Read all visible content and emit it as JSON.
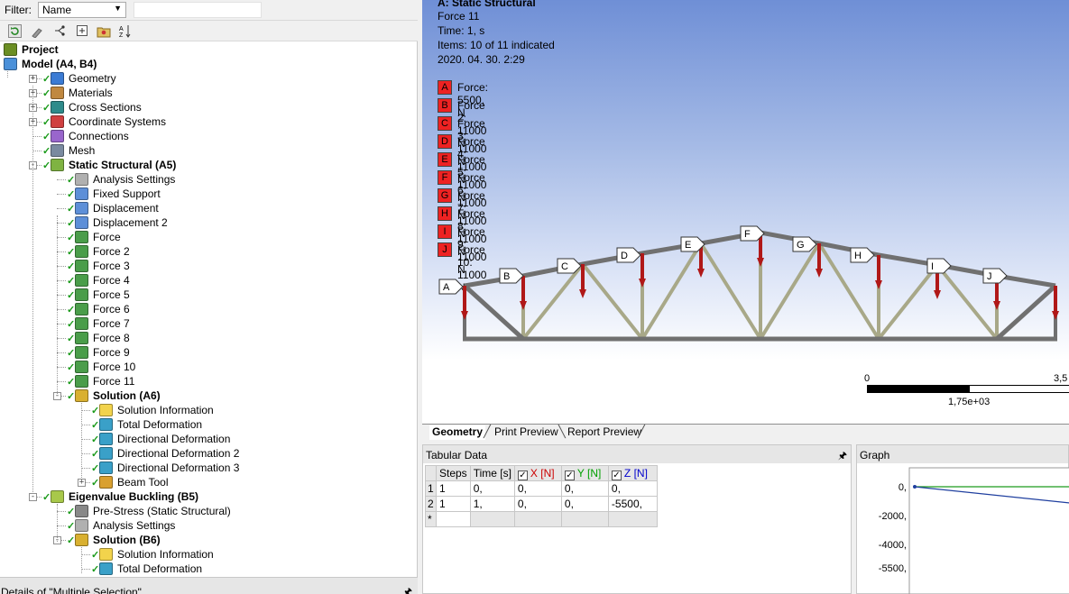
{
  "filter": {
    "label": "Filter:",
    "selected": "Name",
    "query": ""
  },
  "toolbar": {
    "icons": [
      "refresh-icon",
      "brush-icon",
      "tree-icon",
      "expand-icon",
      "folder-icon",
      "sort-az-icon"
    ]
  },
  "tree": [
    {
      "id": "project",
      "label": "Project",
      "bold": true,
      "level": 0,
      "icon": "project-icon",
      "color": "#6b8e23"
    },
    {
      "id": "model",
      "label": "Model (A4, B4)",
      "bold": true,
      "level": 0,
      "expander": "-",
      "icon": "model-icon",
      "color": "#4a90d9"
    },
    {
      "id": "geometry",
      "label": "Geometry",
      "level": 1,
      "expander": "+",
      "check": true,
      "icon": "geometry-icon",
      "color": "#3b7bd4"
    },
    {
      "id": "materials",
      "label": "Materials",
      "level": 1,
      "expander": "+",
      "check": true,
      "icon": "materials-icon",
      "color": "#c08840"
    },
    {
      "id": "cross-sections",
      "label": "Cross Sections",
      "level": 1,
      "expander": "+",
      "check": true,
      "icon": "cross-section-icon",
      "color": "#2e8b8b"
    },
    {
      "id": "coordinate-systems",
      "label": "Coordinate Systems",
      "level": 1,
      "expander": "+",
      "check": true,
      "icon": "coordinate-icon",
      "color": "#d04040"
    },
    {
      "id": "connections",
      "label": "Connections",
      "level": 1,
      "check": true,
      "icon": "connections-icon",
      "color": "#9966cc"
    },
    {
      "id": "mesh",
      "label": "Mesh",
      "level": 1,
      "check": true,
      "icon": "mesh-icon",
      "color": "#7a8aa0"
    },
    {
      "id": "static-structural",
      "label": "Static Structural (A5)",
      "bold": true,
      "level": 1,
      "expander": "-",
      "check": true,
      "icon": "static-structural-icon",
      "color": "#7fb342"
    },
    {
      "id": "analysis-settings",
      "label": "Analysis Settings",
      "level": 2,
      "check": true,
      "icon": "analysis-settings-icon",
      "color": "#b0b0b0"
    },
    {
      "id": "fixed-support",
      "label": "Fixed Support",
      "level": 2,
      "check": true,
      "icon": "fixed-support-icon",
      "color": "#5d8fd8"
    },
    {
      "id": "displacement",
      "label": "Displacement",
      "level": 2,
      "check": true,
      "icon": "displacement-icon",
      "color": "#5d8fd8"
    },
    {
      "id": "displacement-2",
      "label": "Displacement 2",
      "level": 2,
      "check": true,
      "icon": "displacement-icon",
      "color": "#5d8fd8"
    },
    {
      "id": "force",
      "label": "Force",
      "level": 2,
      "check": true,
      "icon": "force-icon",
      "color": "#4a9d4a"
    },
    {
      "id": "force-2",
      "label": "Force 2",
      "level": 2,
      "check": true,
      "icon": "force-icon",
      "color": "#4a9d4a"
    },
    {
      "id": "force-3",
      "label": "Force 3",
      "level": 2,
      "check": true,
      "icon": "force-icon",
      "color": "#4a9d4a"
    },
    {
      "id": "force-4",
      "label": "Force 4",
      "level": 2,
      "check": true,
      "icon": "force-icon",
      "color": "#4a9d4a"
    },
    {
      "id": "force-5",
      "label": "Force 5",
      "level": 2,
      "check": true,
      "icon": "force-icon",
      "color": "#4a9d4a"
    },
    {
      "id": "force-6",
      "label": "Force 6",
      "level": 2,
      "check": true,
      "icon": "force-icon",
      "color": "#4a9d4a"
    },
    {
      "id": "force-7",
      "label": "Force 7",
      "level": 2,
      "check": true,
      "icon": "force-icon",
      "color": "#4a9d4a"
    },
    {
      "id": "force-8",
      "label": "Force 8",
      "level": 2,
      "check": true,
      "icon": "force-icon",
      "color": "#4a9d4a"
    },
    {
      "id": "force-9",
      "label": "Force 9",
      "level": 2,
      "check": true,
      "icon": "force-icon",
      "color": "#4a9d4a"
    },
    {
      "id": "force-10",
      "label": "Force 10",
      "level": 2,
      "check": true,
      "icon": "force-icon",
      "color": "#4a9d4a"
    },
    {
      "id": "force-11",
      "label": "Force 11",
      "level": 2,
      "check": true,
      "icon": "force-icon",
      "color": "#4a9d4a"
    },
    {
      "id": "solution-a6",
      "label": "Solution (A6)",
      "bold": true,
      "level": 2,
      "expander": "-",
      "check": true,
      "icon": "solution-icon",
      "color": "#d9b030"
    },
    {
      "id": "solution-information",
      "label": "Solution Information",
      "level": 3,
      "check": true,
      "icon": "solution-info-icon",
      "color": "#f2d34c"
    },
    {
      "id": "total-deformation",
      "label": "Total Deformation",
      "level": 3,
      "check": true,
      "icon": "result-icon",
      "color": "#3aa0c8"
    },
    {
      "id": "directional-deformation",
      "label": "Directional Deformation",
      "level": 3,
      "check": true,
      "icon": "result-icon",
      "color": "#3aa0c8"
    },
    {
      "id": "directional-deformation-2",
      "label": "Directional Deformation 2",
      "level": 3,
      "check": true,
      "icon": "result-icon",
      "color": "#3aa0c8"
    },
    {
      "id": "directional-deformation-3",
      "label": "Directional Deformation 3",
      "level": 3,
      "check": true,
      "icon": "result-icon",
      "color": "#3aa0c8"
    },
    {
      "id": "beam-tool",
      "label": "Beam Tool",
      "level": 3,
      "expander": "+",
      "check": true,
      "icon": "beam-tool-icon",
      "color": "#d9a030"
    },
    {
      "id": "eigenvalue-buckling",
      "label": "Eigenvalue Buckling (B5)",
      "bold": true,
      "level": 1,
      "expander": "-",
      "check": true,
      "icon": "eigenvalue-icon",
      "color": "#a8c84a"
    },
    {
      "id": "pre-stress",
      "label": "Pre-Stress (Static Structural)",
      "level": 2,
      "check": true,
      "icon": "pre-stress-icon",
      "color": "#888888"
    },
    {
      "id": "analysis-settings-b",
      "label": "Analysis Settings",
      "level": 2,
      "check": true,
      "icon": "analysis-settings-icon",
      "color": "#b0b0b0"
    },
    {
      "id": "solution-b6",
      "label": "Solution (B6)",
      "bold": true,
      "level": 2,
      "expander": "-",
      "check": true,
      "icon": "solution-icon",
      "color": "#d9b030"
    },
    {
      "id": "solution-information-b",
      "label": "Solution Information",
      "level": 3,
      "check": true,
      "icon": "solution-info-icon",
      "color": "#f2d34c"
    },
    {
      "id": "total-deformation-b",
      "label": "Total Deformation",
      "level": 3,
      "check": true,
      "icon": "result-icon",
      "color": "#3aa0c8"
    }
  ],
  "details": {
    "title": "Details of \"Multiple Selection\"",
    "pin_icon": "pin-icon"
  },
  "viewport": {
    "title": "A: Static Structural",
    "object": "Force 11",
    "time": "Time: 1, s",
    "items": "Items: 10 of 11 indicated",
    "date": "2020. 04. 30. 2:29",
    "legend": [
      {
        "key": "A",
        "text": "Force: 5500, N"
      },
      {
        "key": "B",
        "text": "Force 2: 11000 N"
      },
      {
        "key": "C",
        "text": "Force 3: 11000 N"
      },
      {
        "key": "D",
        "text": "Force 4: 11000 N"
      },
      {
        "key": "E",
        "text": "Force 5: 11000 N"
      },
      {
        "key": "F",
        "text": "Force 6: 11000 N"
      },
      {
        "key": "G",
        "text": "Force 7: 11000 N"
      },
      {
        "key": "H",
        "text": "Force 8: 11000 N"
      },
      {
        "key": "I",
        "text": "Force 9: 11000 N"
      },
      {
        "key": "J",
        "text": "Force 10: 11000 N"
      }
    ],
    "scale": {
      "zero": "0",
      "max": "3,5",
      "mid": "1,75e+03"
    },
    "colors": {
      "force_box": "#ee2222",
      "arrow": "#b01818",
      "chord": "#707070",
      "web": "#a8a888"
    }
  },
  "tabs": [
    "Geometry",
    "Print Preview",
    "Report Preview"
  ],
  "tabular": {
    "title": "Tabular Data",
    "columns": [
      "Steps",
      "Time [s]",
      "X [N]",
      "Y [N]",
      "Z [N]"
    ],
    "column_colors": [
      "#000000",
      "#000000",
      "#cc0000",
      "#00a000",
      "#0000cc"
    ],
    "rows": [
      {
        "index": "1",
        "cells": [
          "1",
          "0,",
          "0,",
          "0,",
          "0,"
        ]
      },
      {
        "index": "2",
        "cells": [
          "1",
          "1,",
          "0,",
          "0,",
          "-5500,"
        ]
      },
      {
        "index": "*",
        "cells": [
          "",
          "",
          "",
          "",
          ""
        ]
      }
    ]
  },
  "graph": {
    "title": "Graph",
    "yticks": [
      "0,",
      "-2000,",
      "-4000,",
      "-5500,"
    ],
    "colors": {
      "z_line": "#1f3f9f",
      "y_line": "#1c9a1c"
    }
  }
}
